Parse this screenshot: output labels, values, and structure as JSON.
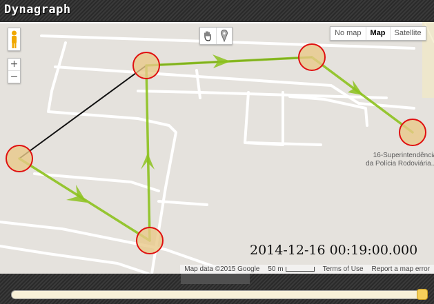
{
  "app": {
    "title": "Dynagraph"
  },
  "map": {
    "type_buttons": [
      "No map",
      "Map",
      "Satellite"
    ],
    "active_type": "Map",
    "poi": {
      "line1": "16-Superintendência",
      "line2": "da Polícia Rodoviária..."
    },
    "attribution": {
      "data": "Map data ©2015 Google",
      "scale": "50 m",
      "terms": "Terms of Use",
      "report": "Report a map error"
    },
    "timestamp": "2014-12-16 00:19:00.000",
    "zoom": {
      "in": "+",
      "out": "−"
    }
  },
  "slider": {
    "value": 1.0
  },
  "colors": {
    "node_fill": "#e9c98a",
    "node_stroke": "#e01010",
    "path": "#8dc21f",
    "edge": "#111111"
  }
}
